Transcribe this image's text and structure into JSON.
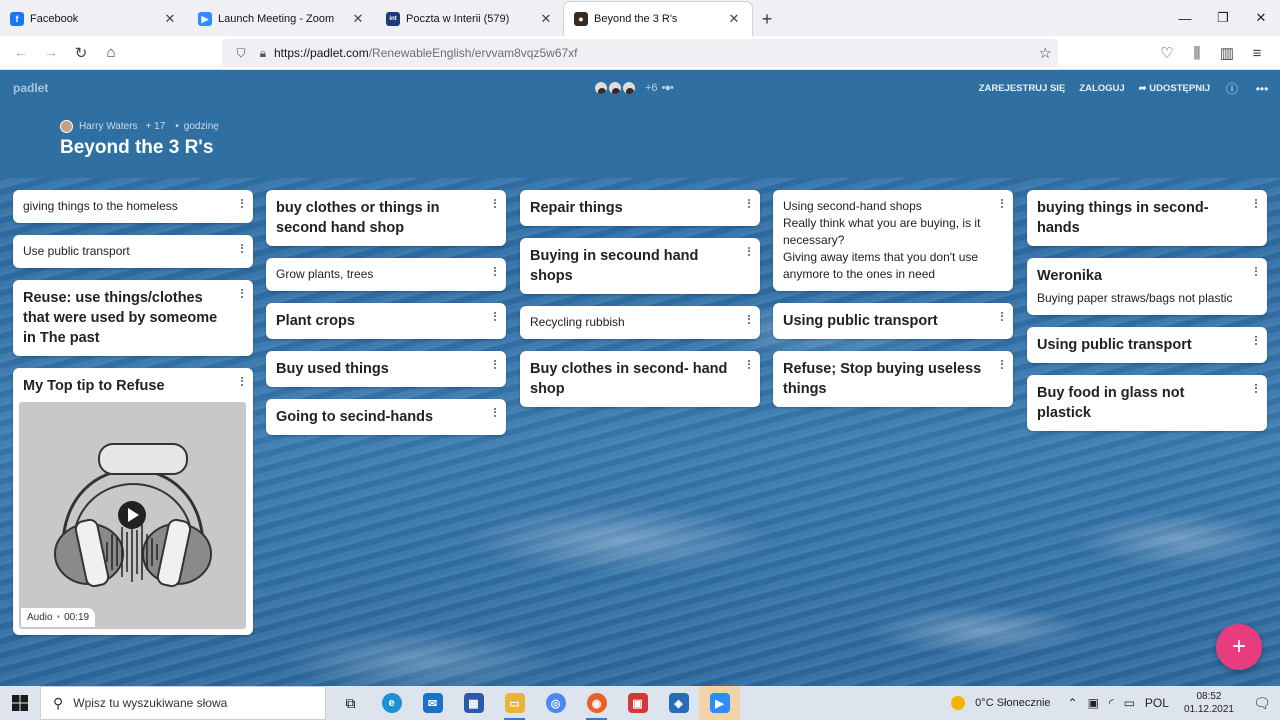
{
  "browser": {
    "tabs": [
      {
        "title": "Facebook",
        "icon": "facebook-icon",
        "color": "#1877f2",
        "glyph": "f"
      },
      {
        "title": "Launch Meeting - Zoom",
        "icon": "zoom-icon",
        "color": "#2d8cff",
        "glyph": "▶"
      },
      {
        "title": "Poczta w Interii (579)",
        "icon": "interia-icon",
        "color": "#1b3c78",
        "glyph": "int"
      },
      {
        "title": "Beyond the 3 R's",
        "icon": "padlet-icon",
        "color": "#3a2a24",
        "glyph": "●"
      }
    ],
    "url_host": "https://padlet.com",
    "url_path": "/RenewableEnglish/ervvam8vqz5w67xf"
  },
  "padlet": {
    "brand": "padlet",
    "collaborators_more": "+6",
    "actions": {
      "signup": "ZAREJESTRUJ SIĘ",
      "login": "ZALOGUJ",
      "share": "UDOSTĘPNIJ"
    },
    "author": "Harry Waters",
    "likes": "+ 17",
    "time": "godzinę",
    "title": "Beyond the 3 R's",
    "columns": [
      [
        {
          "text": "giving things to the homeless"
        },
        {
          "text": "Use public transport"
        },
        {
          "title": "Reuse: use things/clothes that were used by someome in The past"
        },
        {
          "title": "My Top tip to Refuse",
          "audio": {
            "label": "Audio",
            "duration": "00:19"
          }
        }
      ],
      [
        {
          "title": "buy clothes or things in second hand shop"
        },
        {
          "text": "Grow plants, trees"
        },
        {
          "title": "Plant crops"
        },
        {
          "title": "Buy used things"
        },
        {
          "title": "Going to secind-hands"
        }
      ],
      [
        {
          "title": "Repair things"
        },
        {
          "title": "Buying in secound hand shops"
        },
        {
          "text": "Recycling rubbish"
        },
        {
          "title": "Buy clothes in second- hand shop"
        }
      ],
      [
        {
          "text": "Using second-hand shops\nReally think what you are buying, is it necessary?\nGiving away items that you don't use anymore to the ones in need"
        },
        {
          "title": "Using public transport"
        },
        {
          "title": "Refuse; Stop buying useless things"
        }
      ],
      [
        {
          "title": "buying things in second-hands"
        },
        {
          "title": "Weronika",
          "text": "Buying paper straws/bags not plastic"
        },
        {
          "title": "Using public transport"
        },
        {
          "title": "Buy food in glass not plastick"
        }
      ]
    ],
    "fab": "+"
  },
  "taskbar": {
    "search_placeholder": "Wpisz tu wyszukiwane słowa",
    "weather": "0°C  Słonecznie",
    "language": "POL",
    "time": "08:52",
    "date": "01.12.2021"
  }
}
